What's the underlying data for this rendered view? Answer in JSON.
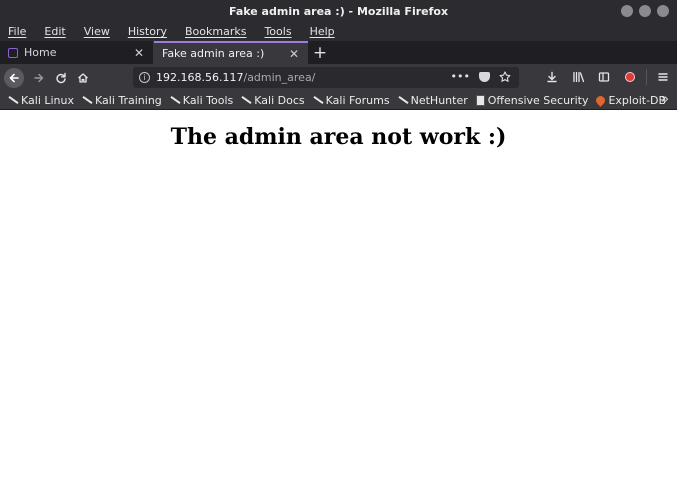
{
  "window": {
    "title": "Fake admin area :) - Mozilla Firefox"
  },
  "menu": {
    "items": [
      "File",
      "Edit",
      "View",
      "History",
      "Bookmarks",
      "Tools",
      "Help"
    ]
  },
  "tabs": [
    {
      "label": "Home",
      "icon": "kali-home-icon",
      "active": false
    },
    {
      "label": "Fake admin area :)",
      "active": true
    }
  ],
  "navbar": {
    "url_host": "192.168.56.117",
    "url_path": "/admin_area/",
    "page_actions_label": "•••"
  },
  "bookmarks": [
    {
      "label": "Kali Linux",
      "icon": "kali-dragon-icon"
    },
    {
      "label": "Kali Training",
      "icon": "kali-dragon-icon"
    },
    {
      "label": "Kali Tools",
      "icon": "kali-dragon-icon"
    },
    {
      "label": "Kali Docs",
      "icon": "kali-dragon-icon"
    },
    {
      "label": "Kali Forums",
      "icon": "kali-dragon-icon"
    },
    {
      "label": "NetHunter",
      "icon": "kali-dragon-icon"
    },
    {
      "label": "Offensive Security",
      "icon": "offsec-icon"
    },
    {
      "label": "Exploit-DB",
      "icon": "exploitdb-icon"
    }
  ],
  "page": {
    "heading": "The admin area not work :)"
  },
  "colors": {
    "chrome_dark": "#2b2b30",
    "toolbar": "#38383d",
    "tab_accent": "#a07be0"
  }
}
